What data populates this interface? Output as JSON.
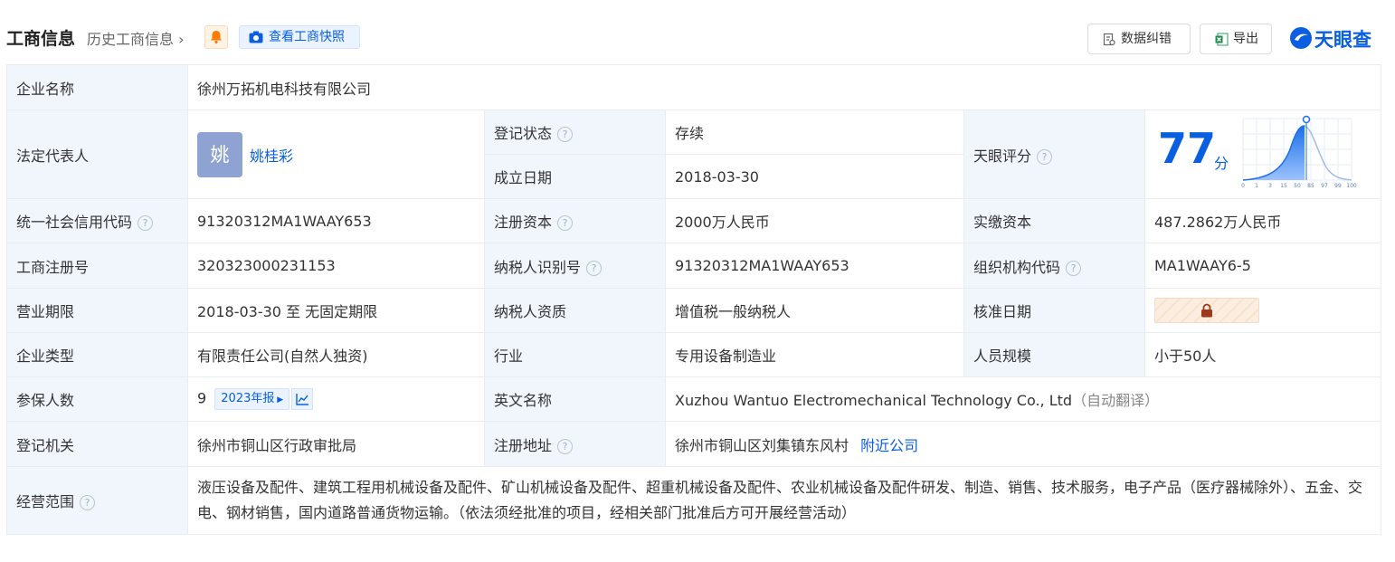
{
  "header": {
    "title": "工商信息",
    "history_label": "历史工商信息",
    "snapshot_label": "查看工商快照",
    "fix_label": "数据纠错",
    "export_label": "导出",
    "logo_text": "天眼查"
  },
  "labels": {
    "company_name": "企业名称",
    "legal_rep": "法定代表人",
    "reg_status": "登记状态",
    "found_date": "成立日期",
    "score": "天眼评分",
    "credit_code": "统一社会信用代码",
    "reg_capital": "注册资本",
    "paid_capital": "实缴资本",
    "reg_number": "工商注册号",
    "taxpayer_id": "纳税人识别号",
    "org_code": "组织机构代码",
    "business_term": "营业期限",
    "taxpayer_qual": "纳税人资质",
    "approval_date": "核准日期",
    "company_type": "企业类型",
    "industry": "行业",
    "staff_size": "人员规模",
    "insured": "参保人数",
    "english_name": "英文名称",
    "reg_authority": "登记机关",
    "reg_address": "注册地址",
    "business_scope": "经营范围"
  },
  "values": {
    "company_name": "徐州万拓机电科技有限公司",
    "avatar_char": "姚",
    "legal_rep": "姚桂彩",
    "reg_status": "存续",
    "found_date": "2018-03-30",
    "score": "77",
    "score_unit": "分",
    "credit_code": "91320312MA1WAAY653",
    "reg_capital": "2000万人民币",
    "paid_capital": "487.2862万人民币",
    "reg_number": "320323000231153",
    "taxpayer_id": "91320312MA1WAAY653",
    "org_code": "MA1WAAY6-5",
    "business_term": "2018-03-30 至 无固定期限",
    "taxpayer_qual": "增值税一般纳税人",
    "company_type": "有限责任公司(自然人独资)",
    "industry": "专用设备制造业",
    "staff_size": "小于50人",
    "insured": "9",
    "insured_report": "2023年报",
    "english_name": "Xuzhou Wantuo Electromechanical Technology Co., Ltd",
    "english_note": "（自动翻译）",
    "reg_authority": "徐州市铜山区行政审批局",
    "reg_address": "徐州市铜山区刘集镇东风村",
    "nearby_link": "附近公司",
    "business_scope": "液压设备及配件、建筑工程用机械设备及配件、矿山机械设备及配件、超重机械设备及配件、农业机械设备及配件研发、制造、销售、技术服务，电子产品（医疗器械除外）、五金、交电、钢材销售，国内道路普通货物运输。（依法须经批准的项目，经相关部门批准后方可开展经营活动）"
  },
  "score_axis": [
    "0",
    "1",
    "3",
    "15",
    "50",
    "85",
    "97",
    "99",
    "100"
  ],
  "colors": {
    "accent": "#0a5fe0",
    "status": "#2aa25d",
    "label_bg": "#f1f6fd"
  }
}
